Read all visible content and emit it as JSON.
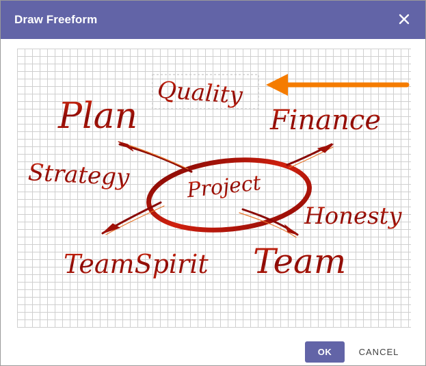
{
  "dialog": {
    "title": "Draw Freeform",
    "close_icon": "close-icon",
    "accent_color": "#6264a7"
  },
  "canvas": {
    "image_words": {
      "center": "Project",
      "quality": "Quality",
      "plan": "Plan",
      "finance": "Finance",
      "strategy": "Strategy",
      "honesty": "Honesty",
      "teamspirit": "TeamSpirit",
      "team": "Team"
    },
    "annotation_arrow_color": "#f57c00"
  },
  "footer": {
    "ok_label": "OK",
    "cancel_label": "CANCEL"
  }
}
